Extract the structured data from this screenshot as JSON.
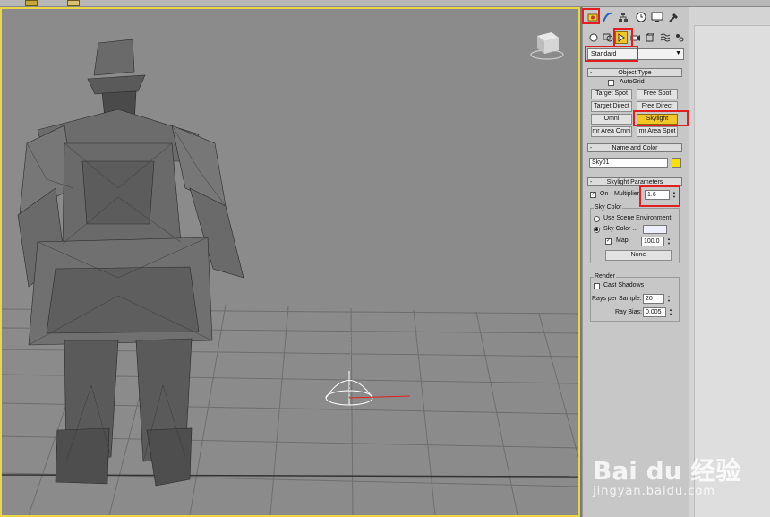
{
  "colors": {
    "viewport_border": "#e8d54a",
    "active_button": "#f2c624",
    "highlight_red": "#e02020",
    "sky_color_swatch": "#eef0ff",
    "object_color_swatch": "#f6e100"
  },
  "command_panel": {
    "tabs": [
      "create-icon",
      "modify-icon",
      "hierarchy-icon",
      "motion-icon",
      "display-icon",
      "utilities-icon"
    ],
    "subcategories": [
      "geometry-icon",
      "shapes-icon",
      "lights-icon",
      "cameras-icon",
      "helpers-icon",
      "spacewarps-icon",
      "systems-icon"
    ],
    "type_dropdown": "Standard"
  },
  "object_type": {
    "title": "Object Type",
    "autogrid": "AutoGrid",
    "buttons": [
      "Target Spot",
      "Free Spot",
      "Target Direct",
      "Free Direct",
      "Omni",
      "Skylight",
      "mr Area Omni",
      "mr Area Spot"
    ]
  },
  "name_color": {
    "title": "Name and Color",
    "name_value": "Sky01"
  },
  "skylight_params": {
    "title": "Skylight Parameters",
    "on_label": "On",
    "multiplier_label": "Multiplier:",
    "multiplier_value": "1.6",
    "sky_color_group": "Sky Color",
    "use_scene_env": "Use Scene Environment",
    "sky_color_label": "Sky Color ...",
    "map_label": "Map:",
    "map_value": "100.0",
    "none_button": "None"
  },
  "render": {
    "group_title": "Render",
    "cast_shadows": "Cast Shadows",
    "rays_label": "Rays per Sample:",
    "rays_value": "20",
    "ray_bias_label": "Ray Bias:",
    "ray_bias_value": "0.005"
  },
  "watermark": {
    "brand": "Bai du 经验",
    "url": "jingyan.baidu.com"
  }
}
